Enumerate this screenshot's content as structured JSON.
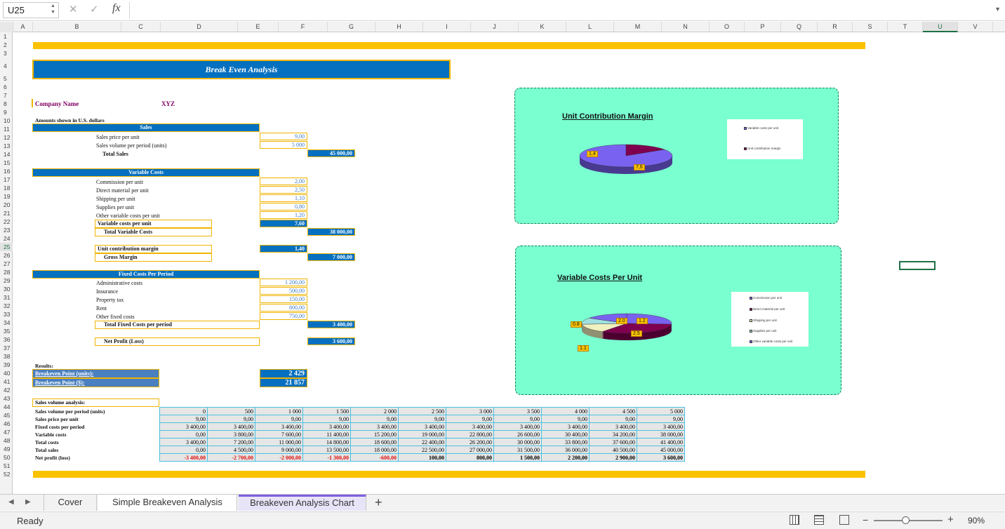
{
  "formula_bar": {
    "name_box": "U25",
    "fx": "fx",
    "formula": ""
  },
  "columns": [
    "A",
    "B",
    "C",
    "D",
    "E",
    "F",
    "G",
    "H",
    "I",
    "J",
    "K",
    "L",
    "M",
    "N",
    "O",
    "P",
    "Q",
    "R",
    "S",
    "T",
    "U",
    "V",
    "W"
  ],
  "rows": [
    "1",
    "2",
    "3",
    "4",
    "5",
    "6",
    "7",
    "8",
    "9",
    "10",
    "11",
    "12",
    "13",
    "14",
    "15",
    "16",
    "17",
    "18",
    "19",
    "20",
    "21",
    "22",
    "23",
    "24",
    "25",
    "26",
    "27",
    "28",
    "29",
    "30",
    "31",
    "32",
    "33",
    "34",
    "35",
    "36",
    "37",
    "38",
    "39",
    "40",
    "41",
    "42",
    "43",
    "44",
    "45",
    "46",
    "47",
    "48",
    "49",
    "50",
    "51",
    "52"
  ],
  "title": "Break Even Analysis",
  "company_label": "Company Name",
  "company_value": "XYZ",
  "amounts_note": "Amounts shown in U.S. dollars",
  "sales": {
    "header": "Sales",
    "price_label": "Sales price per unit",
    "price": "9,00",
    "volume_label": "Sales volume per period (units)",
    "volume": "5 000",
    "total_label": "Total Sales",
    "total": "45 000,00"
  },
  "variable": {
    "header": "Variable Costs",
    "items": [
      {
        "label": "Commission per unit",
        "value": "2,00"
      },
      {
        "label": "Direct material per unit",
        "value": "2,50"
      },
      {
        "label": "Shipping per unit",
        "value": "1,10"
      },
      {
        "label": "Supplies per unit",
        "value": "0,80"
      },
      {
        "label": "Other variable costs per unit",
        "value": "1,20"
      }
    ],
    "per_unit_label": "Variable costs per unit",
    "per_unit": "7,60",
    "total_label": "Total Variable Costs",
    "total": "38 000,00"
  },
  "margin": {
    "ucm_label": "Unit contribution margin",
    "ucm": "1,40",
    "gross_label": "Gross Margin",
    "gross": "7 000,00"
  },
  "fixed": {
    "header": "Fixed Costs Per Period",
    "items": [
      {
        "label": "Administrative costs",
        "value": "1 200,00"
      },
      {
        "label": "Insurance",
        "value": "500,00"
      },
      {
        "label": "Property tax",
        "value": "150,00"
      },
      {
        "label": "Rent",
        "value": "800,00"
      },
      {
        "label": "Other fixed costs",
        "value": "750,00"
      }
    ],
    "total_label": "Total Fixed Costs per period",
    "total": "3 400,00"
  },
  "net": {
    "label": "Net Profit (Loss)",
    "value": "3 600,00"
  },
  "results": {
    "label": "Results:",
    "units_label": "Breakeven Point (units):",
    "units": "2 429",
    "dollars_label": "Breakeven Point ($):",
    "dollars": "21 857"
  },
  "sva": {
    "title": "Sales volume analysis:",
    "labels": [
      "Sales volume per period (units)",
      "Sales price per unit",
      "Fixed costs per period",
      "Variable costs",
      "Total costs",
      "Total sales",
      "Net profit (loss)"
    ],
    "rows": [
      [
        "0",
        "500",
        "1 000",
        "1 500",
        "2 000",
        "2 500",
        "3 000",
        "3 500",
        "4 000",
        "4 500",
        "5 000"
      ],
      [
        "9,00",
        "9,00",
        "9,00",
        "9,00",
        "9,00",
        "9,00",
        "9,00",
        "9,00",
        "9,00",
        "9,00",
        "9,00"
      ],
      [
        "3 400,00",
        "3 400,00",
        "3 400,00",
        "3 400,00",
        "3 400,00",
        "3 400,00",
        "3 400,00",
        "3 400,00",
        "3 400,00",
        "3 400,00",
        "3 400,00"
      ],
      [
        "0,00",
        "3 800,00",
        "7 600,00",
        "11 400,00",
        "15 200,00",
        "19 000,00",
        "22 800,00",
        "26 600,00",
        "30 400,00",
        "34 200,00",
        "38 000,00"
      ],
      [
        "3 400,00",
        "7 200,00",
        "11 000,00",
        "14 800,00",
        "18 600,00",
        "22 400,00",
        "26 200,00",
        "30 000,00",
        "33 800,00",
        "37 600,00",
        "41 400,00"
      ],
      [
        "0,00",
        "4 500,00",
        "9 000,00",
        "13 500,00",
        "18 000,00",
        "22 500,00",
        "27 000,00",
        "31 500,00",
        "36 000,00",
        "40 500,00",
        "45 000,00"
      ],
      [
        "-3 400,00",
        "-2 700,00",
        "-2 000,00",
        "-1 300,00",
        "-600,00",
        "100,00",
        "800,00",
        "1 500,00",
        "2 200,00",
        "2 900,00",
        "3 600,00"
      ]
    ]
  },
  "chart_data": [
    {
      "type": "pie",
      "title": "Unit Contribution Margin",
      "series": [
        {
          "values": [
            7.6,
            1.4
          ]
        }
      ],
      "categories": [
        "Variable costs per unit",
        "Unit contribution margin"
      ],
      "data_labels": [
        "7,6",
        "1,4"
      ],
      "colors": [
        "#7a62f0",
        "#800050"
      ]
    },
    {
      "type": "pie",
      "title": "Variable Costs Per Unit",
      "series": [
        {
          "values": [
            2.0,
            2.5,
            1.1,
            0.8,
            1.2
          ]
        }
      ],
      "categories": [
        "Commission per unit",
        "Direct material per unit",
        "Shipping per unit",
        "Supplies per unit",
        "Other variable costs per unit"
      ],
      "data_labels": [
        "2.0",
        "2.5",
        "1.1",
        "0.8",
        "1.2"
      ],
      "colors": [
        "#7a62f0",
        "#800050",
        "#f0f0c0",
        "#a0e0e0",
        "#7a62f0"
      ]
    }
  ],
  "tabs": [
    "Cover",
    "Simple Breakeven Analysis",
    "Breakeven Analysis Chart"
  ],
  "status": {
    "ready": "Ready",
    "zoom": "90%"
  }
}
